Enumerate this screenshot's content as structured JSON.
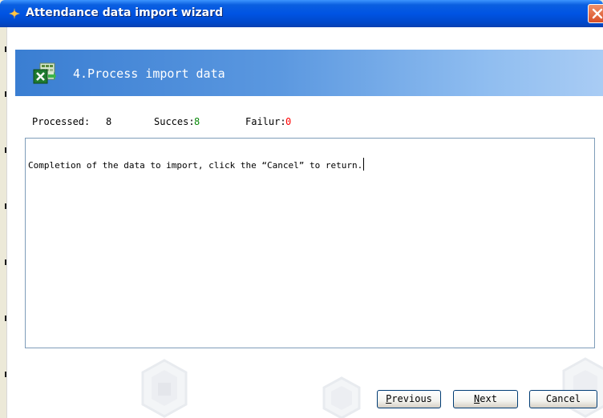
{
  "window": {
    "title": "Attendance data import wizard"
  },
  "header": {
    "step_title": "4.Process import data"
  },
  "stats": {
    "processed_label": "Processed:",
    "processed_value": "8",
    "success_label": "Succes:",
    "success_value": "8",
    "failure_label": "Failur:",
    "failure_value": "0"
  },
  "log": {
    "text": "Completion of the data to import, click the “Cancel” to return."
  },
  "buttons": {
    "previous": "Previous",
    "next": "Next",
    "cancel": "Cancel"
  },
  "colors": {
    "titlebar": "#0054e3",
    "banner": "#3a7ed2",
    "success": "#0a8a0a",
    "failure": "#ff0000"
  },
  "icons": {
    "title": "app-icon",
    "header": "excel-import-icon",
    "close": "close-icon"
  }
}
